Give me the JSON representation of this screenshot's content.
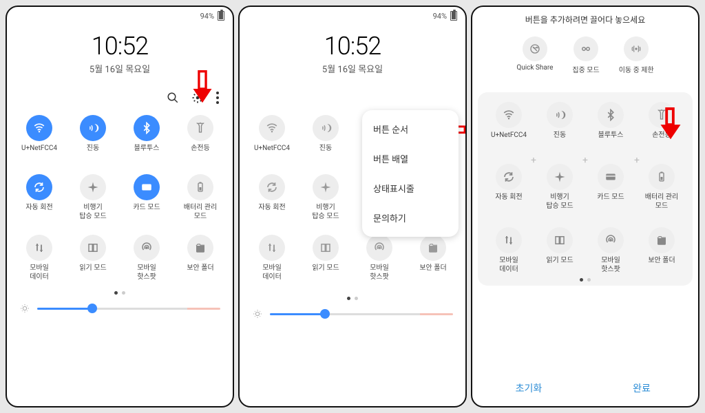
{
  "status": {
    "battery_pct": "94%",
    "bt": "⁕",
    "vibrate": "✶",
    "wifi": "⌔",
    "dnd": "⊘"
  },
  "clock": "10:52",
  "date": "5월 16일 목요일",
  "panel3_header": "버튼을 추가하려면 끌어다 놓으세요",
  "tiles": [
    {
      "id": "wifi",
      "label": "U+NetFCC4",
      "on": true
    },
    {
      "id": "vibrate",
      "label": "진동",
      "on": true
    },
    {
      "id": "bluetooth",
      "label": "블루투스",
      "on": true
    },
    {
      "id": "flashlight",
      "label": "손전등",
      "on": false
    },
    {
      "id": "rotate",
      "label": "자동 회전",
      "on": true
    },
    {
      "id": "airplane",
      "label": "비행기\n탑승 모드",
      "on": false
    },
    {
      "id": "card",
      "label": "카드 모드",
      "on": true
    },
    {
      "id": "battery",
      "label": "배터리 관리\n모드",
      "on": false
    },
    {
      "id": "mobiledata",
      "label": "모바일\n데이터",
      "on": false
    },
    {
      "id": "read",
      "label": "읽기 모드",
      "on": false
    },
    {
      "id": "hotspot",
      "label": "모바일\n핫스팟",
      "on": false
    },
    {
      "id": "secure",
      "label": "보안 폴더",
      "on": false
    }
  ],
  "available": [
    {
      "id": "quickshare",
      "label": "Quick Share"
    },
    {
      "id": "focus",
      "label": "집중 모드"
    },
    {
      "id": "motion",
      "label": "이동 중 제한"
    }
  ],
  "menu": {
    "items": [
      "버튼 순서",
      "버튼 배열",
      "상태표시줄",
      "문의하기"
    ]
  },
  "bottom": {
    "reset": "초기화",
    "done": "완료"
  }
}
